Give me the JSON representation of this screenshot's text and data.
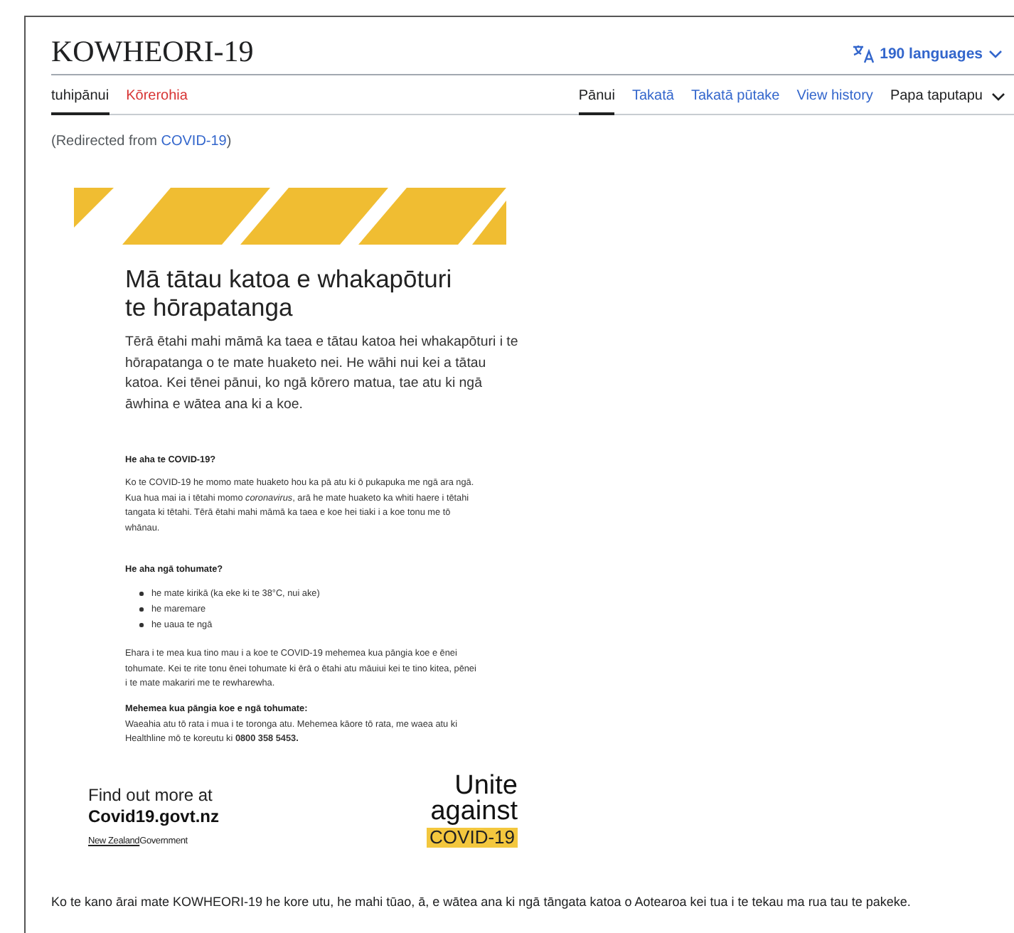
{
  "page": {
    "title": "KOWHEORI-19",
    "languages": "190 languages"
  },
  "tabs_left": [
    {
      "label": "tuhipānui",
      "selected": true,
      "kind": "plain"
    },
    {
      "label": "Kōrerohia",
      "selected": false,
      "kind": "missing"
    }
  ],
  "tabs_right": [
    {
      "label": "Pānui",
      "selected": true,
      "kind": "plain"
    },
    {
      "label": "Takatā",
      "selected": false,
      "kind": "link"
    },
    {
      "label": "Takatā pūtake",
      "selected": false,
      "kind": "link"
    },
    {
      "label": "View history",
      "selected": false,
      "kind": "link"
    },
    {
      "label": "Papa taputapu",
      "selected": false,
      "kind": "menu"
    }
  ],
  "redirect": {
    "prefix": "(Redirected from ",
    "link": "COVID-19",
    "suffix": ")"
  },
  "poster": {
    "heading_lines": [
      "Mā tātau katoa e whakapōturi",
      "te hōrapatanga"
    ],
    "intro": "Tērā ētahi mahi māmā ka taea e tātau katoa hei whakapōturi i te hōrapatanga o te mate huaketo nei. He wāhi nui kei a tātau katoa. Kei tēnei pānui, ko ngā kōrero matua, tae atu ki ngā āwhina e wātea ana ki a koe.",
    "q1": "He aha te COVID-19?",
    "a1": "Ko te COVID-19 he momo mate huaketo hou ka pā atu ki ō pukapuka me ngā ara ngā. Kua hua mai ia i tētahi momo *coronavirus*, arā he mate huaketo ka whiti haere i tētahi tangata ki tētahi. Tērā ētahi mahi māmā ka taea e koe hei tiaki i a koe tonu me tō whānau.",
    "q2": "He aha ngā tohumate?",
    "symptoms": [
      "he mate kirikā (ka eke ki te 38°C, nui ake)",
      "he maremare",
      "he uaua te ngā"
    ],
    "a2": "Ehara i te mea kua tino mau i a koe te COVID-19 mehemea kua pāngia koe e ēnei tohumate. Kei te rite tonu ēnei tohumate ki ērā o ētahi atu māuiui kei te tino kitea, pēnei i te mate makariri me te rewharewha.",
    "q3": "Mehemea kua pāngia koe e ngā tohumate:",
    "a3": "Waeahia atu tō rata i mua i te toronga atu. Mehemea kāore tō rata, me waea atu ki Healthline mō te koreutu ki **0800 358 5453.**",
    "find_more": "Find out more at",
    "site": "Covid19.govt.nz",
    "gov_prefix": "New Zealand",
    "gov_suffix": "Government",
    "slogan_lines": [
      "Unite",
      "against"
    ],
    "slogan_badge": "COVID-19"
  },
  "paragraph": "Ko te kano ārai mate KOWHEORI-19 he kore utu, he mahi tūao, ā, e wātea ana ki ngā tāngata katoa o Aotearoa kei tua i te tekau ma rua tau te pakeke."
}
